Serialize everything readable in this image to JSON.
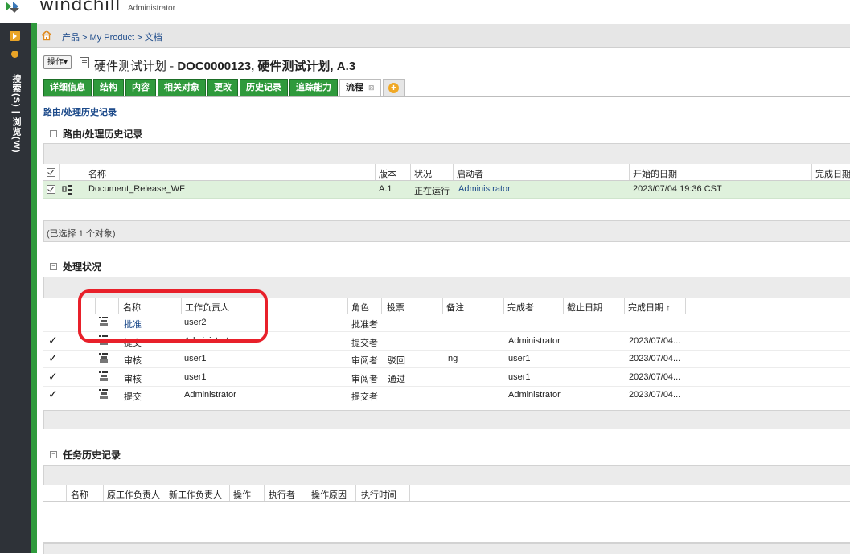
{
  "brand": {
    "name": "windchill",
    "user": "Administrator"
  },
  "rail": {
    "text": "搜索(S) | 浏览(W)"
  },
  "breadcrumb": "产品 > My Product > 文档",
  "header": {
    "action_label": "操作▾",
    "title_prefix": "硬件测试计划 - ",
    "title_bold": "DOC0000123, 硬件测试计划, A.3"
  },
  "tabs": [
    {
      "label": "详细信息"
    },
    {
      "label": "结构"
    },
    {
      "label": "内容"
    },
    {
      "label": "相关对象"
    },
    {
      "label": "更改"
    },
    {
      "label": "历史记录"
    },
    {
      "label": "追踪能力"
    },
    {
      "label": "流程",
      "close": "⊠"
    }
  ],
  "subheading": "路由/处理历史记录",
  "routing": {
    "title": "路由/处理历史记录",
    "headers": [
      "名称",
      "版本",
      "状况",
      "启动者",
      "开始的日期",
      "完成日期"
    ],
    "row": {
      "name": "Document_Release_WF",
      "version": "A.1",
      "status": "正在运行",
      "initiator": "Administrator",
      "start": "2023/07/04 19:36 CST"
    },
    "footer": "(已选择 1 个对象)"
  },
  "process": {
    "title": "处理状况",
    "headers": [
      "名称",
      "工作负责人",
      "角色",
      "投票",
      "备注",
      "完成者",
      "截止日期",
      "完成日期"
    ],
    "sort_indicator": "↑",
    "rows": [
      {
        "done": "",
        "name": "批准",
        "owner": "user2",
        "role": "批准者",
        "vote": "",
        "note": "",
        "completed_by": "",
        "due": "",
        "date": "",
        "link": true
      },
      {
        "done": "✓",
        "name": "提交",
        "owner": "Administrator",
        "role": "提交者",
        "vote": "",
        "note": "",
        "completed_by": "Administrator",
        "due": "",
        "date": "2023/07/04..."
      },
      {
        "done": "✓",
        "name": "审核",
        "owner": "user1",
        "role": "审阅者",
        "vote": "驳回",
        "note": "ng",
        "completed_by": "user1",
        "due": "",
        "date": "2023/07/04..."
      },
      {
        "done": "✓",
        "name": "审核",
        "owner": "user1",
        "role": "审阅者",
        "vote": "通过",
        "note": "",
        "completed_by": "user1",
        "due": "",
        "date": "2023/07/04..."
      },
      {
        "done": "✓",
        "name": "提交",
        "owner": "Administrator",
        "role": "提交者",
        "vote": "",
        "note": "",
        "completed_by": "Administrator",
        "due": "",
        "date": "2023/07/04..."
      }
    ]
  },
  "task_history": {
    "title": "任务历史记录",
    "headers": [
      "名称",
      "原工作负责人",
      "新工作负责人",
      "操作",
      "执行者",
      "操作原因",
      "执行时间"
    ]
  },
  "colors": {
    "green": "#2f9a3c",
    "rail": "#2e3238",
    "link": "#1c4a8a",
    "annotation": "#e8202a"
  }
}
